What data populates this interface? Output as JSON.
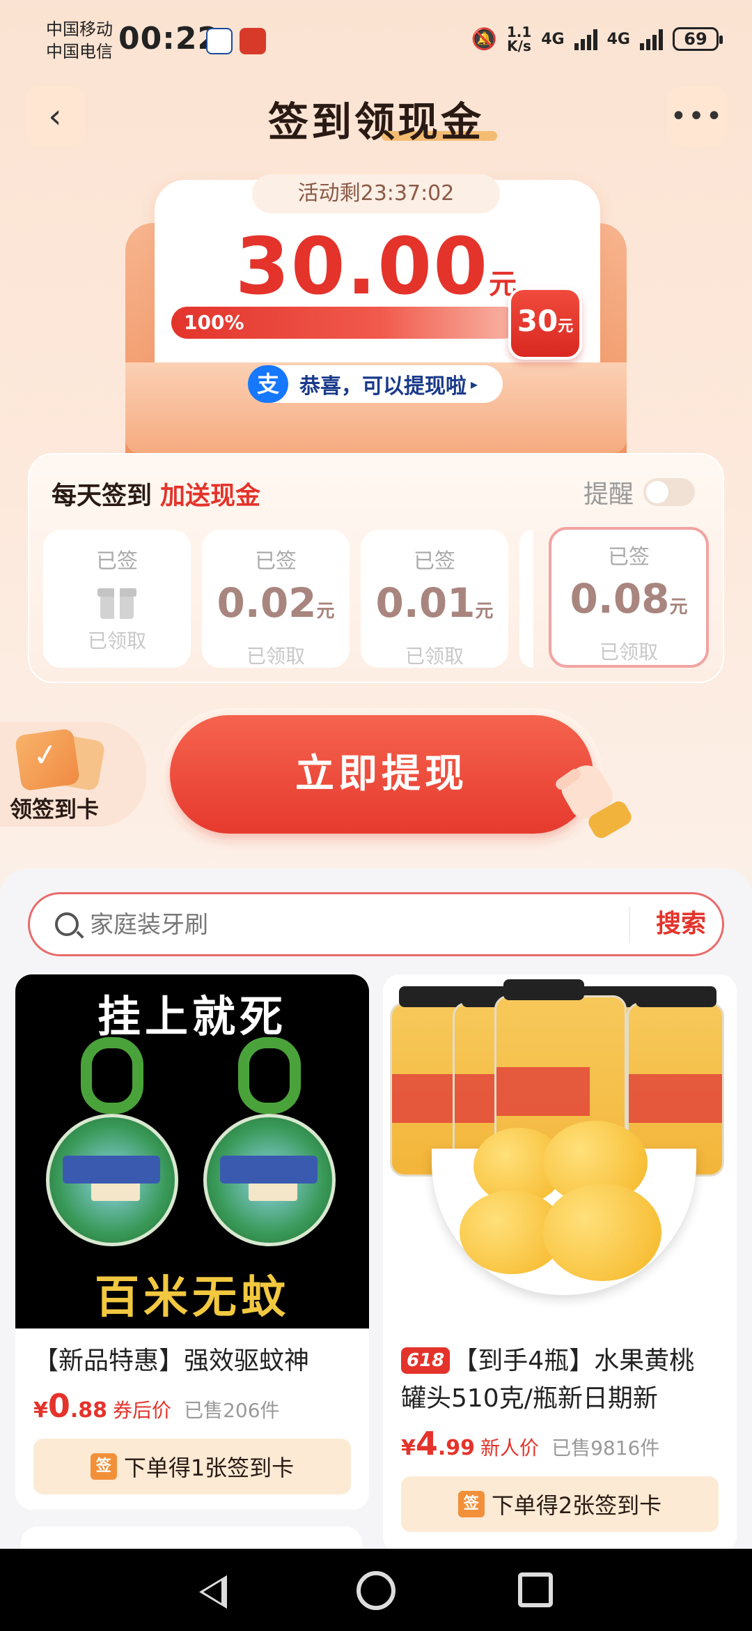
{
  "status_bar": {
    "carrier1": "中国移动",
    "carrier2": "中国电信",
    "time": "00:22",
    "speed_value": "1.1",
    "speed_unit": "K/s",
    "net1": "4G",
    "net2": "4G",
    "battery": "69"
  },
  "header": {
    "title": "签到领现金",
    "more": "•••",
    "back": "‹"
  },
  "reward_card": {
    "timer": "活动剩23:37:02",
    "amount": "30.00",
    "amount_unit": "元",
    "progress_label": "100%",
    "progress_fraction": 1.0,
    "goal_amount": "30",
    "goal_unit": "元",
    "alipay_icon": "支",
    "alipay_text": "恭喜，可以提现啦",
    "alipay_arrow": "▸"
  },
  "signin": {
    "title": "每天签到",
    "bonus": "加送现金",
    "remind_label": "提醒",
    "days": [
      {
        "status": "已签",
        "value": "",
        "unit": "",
        "claim": "已领取",
        "icon": "gift-icon"
      },
      {
        "status": "已签",
        "value": "0.02",
        "unit": "元",
        "claim": "已领取"
      },
      {
        "status": "已签",
        "value": "0.01",
        "unit": "元",
        "claim": "已领取"
      },
      {
        "status": "已签",
        "value": "0.08",
        "unit": "元",
        "claim": "已领取"
      }
    ]
  },
  "actions": {
    "sign_card_label": "领签到卡",
    "withdraw_label": "立即提现"
  },
  "search": {
    "placeholder": "家庭装牙刷",
    "button": "搜索"
  },
  "products": [
    {
      "image_top_text": "挂上就死",
      "image_bottom_text": "百米无蚊",
      "badge": "",
      "title": "【新品特惠】强效驱蚊神",
      "currency": "¥",
      "price_int": "0",
      "price_dec": ".88",
      "price_label": "券后价",
      "sold": "已售206件",
      "reward_icon": "签",
      "reward": "下单得1张签到卡"
    },
    {
      "badge": "618",
      "title": "【到手4瓶】水果黄桃罐头510克/瓶新日期新",
      "currency": "¥",
      "price_int": "4",
      "price_dec": ".99",
      "price_label": "新人价",
      "sold": "已售9816件",
      "reward_icon": "签",
      "reward": "下单得2张签到卡"
    }
  ],
  "colors": {
    "accent_red": "#e4332b",
    "alipay_blue": "#1677ff",
    "reward_bg": "#fcead4"
  }
}
